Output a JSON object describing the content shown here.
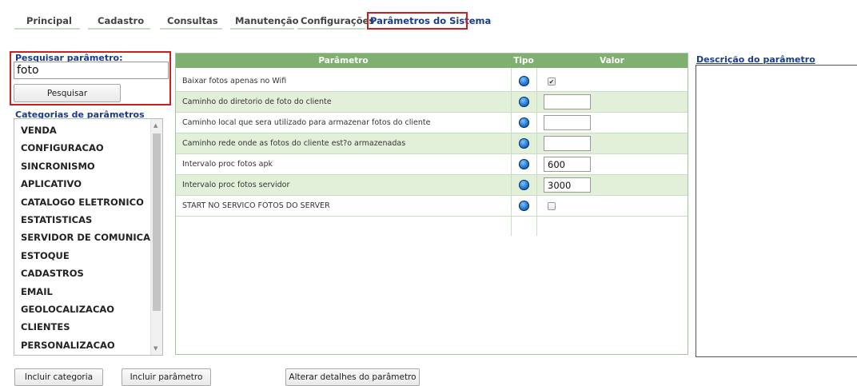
{
  "nav": {
    "items": [
      "Principal",
      "Cadastro",
      "Consultas",
      "Manutenção",
      "Configurações",
      "Parâmetros do Sistema"
    ]
  },
  "search": {
    "label": "Pesquisar parâmetro:",
    "value": "foto",
    "button": "Pesquisar"
  },
  "categories": {
    "label": "Categorias de parâmetros",
    "items": [
      "VENDA",
      "CONFIGURACAO",
      "SINCRONISMO",
      "APLICATIVO",
      "CATALOGO ELETRONICO",
      "ESTATISTICAS",
      "SERVIDOR DE COMUNICACAO",
      "ESTOQUE",
      "CADASTROS",
      "EMAIL",
      "GEOLOCALIZACAO",
      "CLIENTES",
      "PERSONALIZACAO"
    ]
  },
  "table": {
    "headers": [
      "Parâmetro",
      "Tipo",
      "Valor"
    ],
    "rows": [
      {
        "name": "Baixar fotos apenas no Wifi",
        "value_type": "checkbox",
        "checked": true
      },
      {
        "name": "Caminho do diretorio de foto do cliente",
        "value_type": "text",
        "value": ""
      },
      {
        "name": "Caminho local que sera utilizado para armazenar fotos do cliente",
        "value_type": "text",
        "value": ""
      },
      {
        "name": "Caminho rede onde as fotos do cliente est?o armazenadas",
        "value_type": "text",
        "value": ""
      },
      {
        "name": "Intervalo proc fotos apk",
        "value_type": "text",
        "value": "600"
      },
      {
        "name": "Intervalo proc fotos servidor",
        "value_type": "text",
        "value": "3000"
      },
      {
        "name": "START NO SERVICO FOTOS DO SERVER",
        "value_type": "checkbox",
        "checked": false
      }
    ]
  },
  "description": {
    "label": "Descrição do parâmetro"
  },
  "actions": {
    "include_category": "Incluir categoria",
    "include_parameter": "Incluir parâmetro",
    "alter_details": "Alterar detalhes do parâmetro"
  },
  "colors": {
    "header_green": "#7fb06f",
    "row_alt": "#e3f0d9",
    "highlight_red": "#cc1f1f",
    "label_blue": "#1a3c8c"
  }
}
